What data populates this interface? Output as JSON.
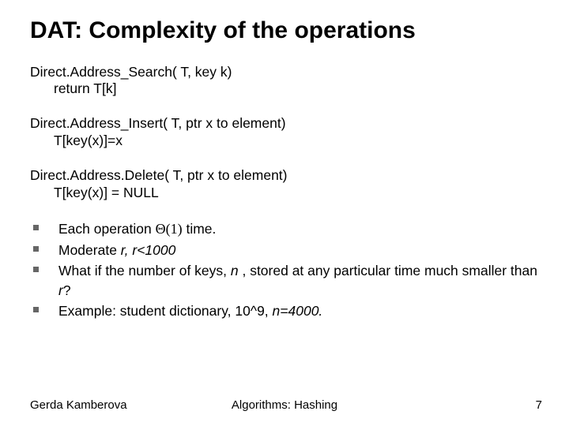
{
  "title": "DAT: Complexity of the operations",
  "ops": {
    "search": {
      "sig": "Direct.Address_Search( T, key k)",
      "body": "return T[k]"
    },
    "insert": {
      "sig": "Direct.Address_Insert( T, ptr x to element)",
      "body": "T[key(x)]=x"
    },
    "delete": {
      "sig": "Direct.Address.Delete( T, ptr x to element)",
      "body": "T[key(x)] = NULL"
    }
  },
  "bullets": {
    "b1_pre": "Each operation ",
    "b1_theta": "Θ(1)",
    "b1_post": "   time.",
    "b2_pre": "Moderate ",
    "b2_it": "r, r<1000",
    "b3_pre": "What if the number of keys, ",
    "b3_n": "n",
    "b3_mid": " , stored at any particular time much smaller than ",
    "b3_r": "r",
    "b3_q": "?",
    "b4_pre": "Example: student dictionary, 10^9, ",
    "b4_it": "n=4000."
  },
  "footer": {
    "left": "Gerda Kamberova",
    "center": "Algorithms: Hashing",
    "right": "7"
  }
}
